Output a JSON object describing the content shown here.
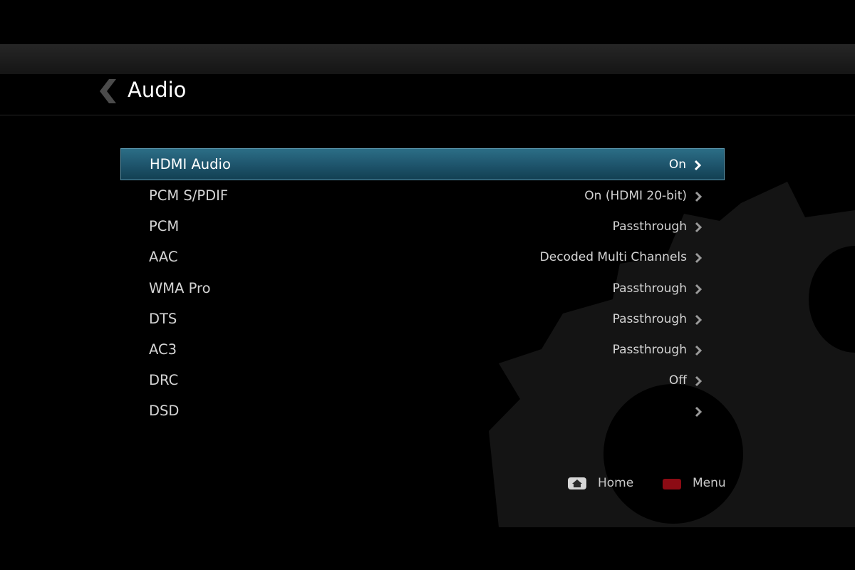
{
  "screen": {
    "title": "Audio"
  },
  "menu": {
    "items": [
      {
        "label": "HDMI Audio",
        "value": "On",
        "selected": true
      },
      {
        "label": "PCM S/PDIF",
        "value": "On (HDMI 20-bit)"
      },
      {
        "label": "PCM",
        "value": "Passthrough"
      },
      {
        "label": "AAC",
        "value": "Decoded Multi Channels"
      },
      {
        "label": "WMA Pro",
        "value": "Passthrough"
      },
      {
        "label": "DTS",
        "value": "Passthrough"
      },
      {
        "label": "AC3",
        "value": "Passthrough"
      },
      {
        "label": "DRC",
        "value": "Off"
      },
      {
        "label": "DSD",
        "value": ""
      }
    ]
  },
  "footer": {
    "home_label": "Home",
    "menu_label": "Menu",
    "home_icon": "home-key-icon",
    "menu_icon": "red-key-icon"
  },
  "colors": {
    "selection": "#205870",
    "menu_key": "#8c0b14",
    "background": "#000000"
  }
}
